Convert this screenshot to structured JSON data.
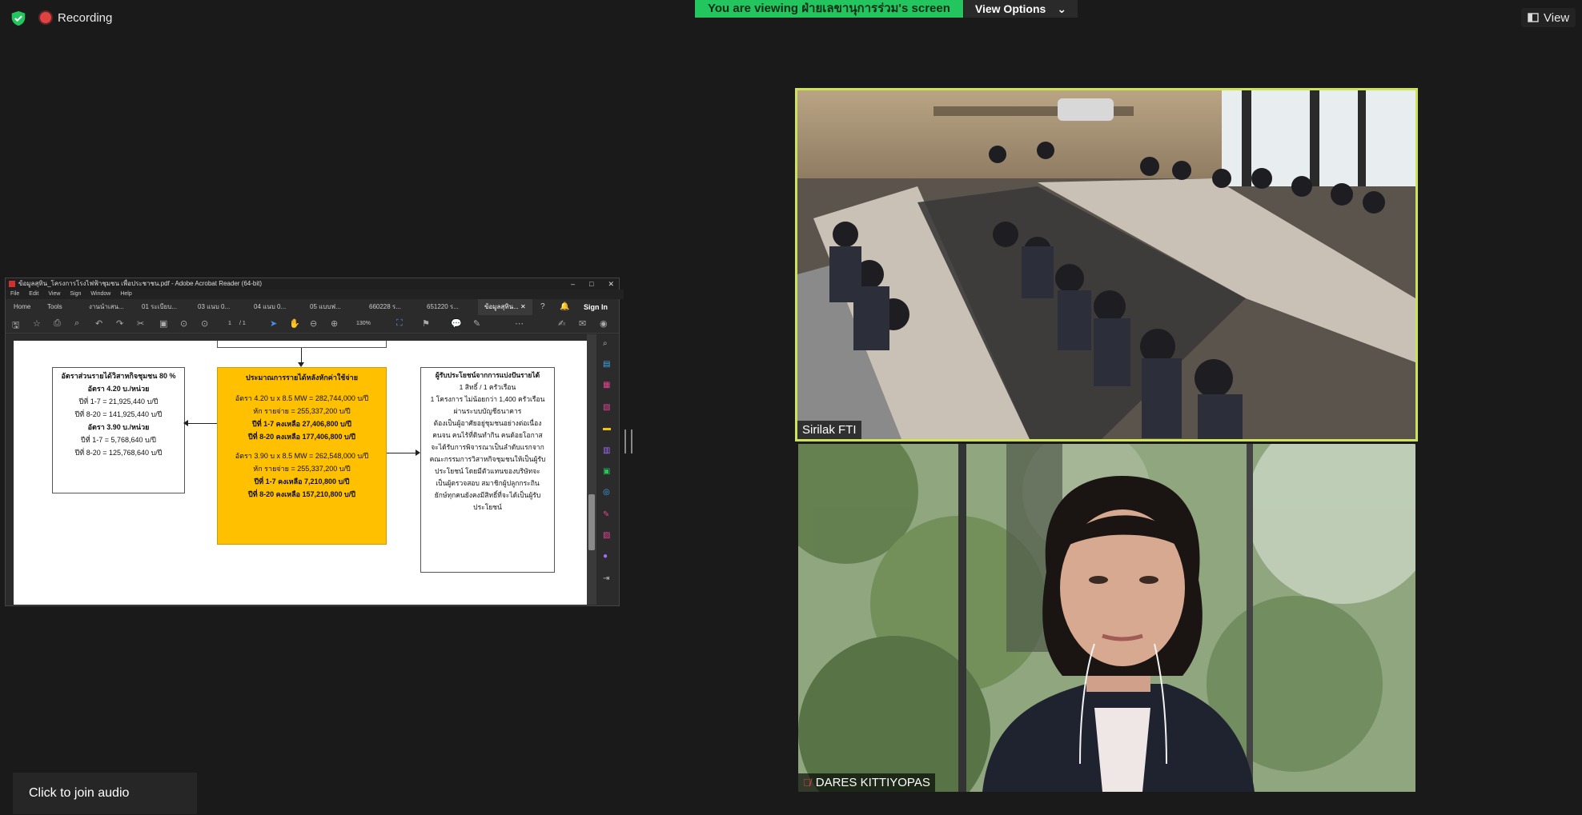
{
  "topbar": {
    "recording_label": "Recording",
    "viewing_banner": "You are viewing ฝ่ายเลขานุการร่วม's screen",
    "view_options_label": "View Options",
    "view_label": "View"
  },
  "acrobat": {
    "window_title": "ข้อมูลสุทิน_โครงการโรงไฟฟ้าชุมชน เพื่อประชาชน.pdf - Adobe Acrobat Reader (64-bit)",
    "menu": [
      "File",
      "Edit",
      "View",
      "Sign",
      "Window",
      "Help"
    ],
    "tabs": {
      "home": "Home",
      "tools": "Tools",
      "docs": [
        "งานนำเสน...",
        "01 ระเบียบ...",
        "03 แนบ 0...",
        "04 แนบ 0...",
        "05 แบบฟ...",
        "660228 ร...",
        "651220 ร...",
        "ข้อมูลสุทิน..."
      ],
      "sign_in": "Sign In"
    },
    "toolbar": {
      "page_current": "1",
      "page_total": "/ 1",
      "zoom": "130%"
    },
    "document": {
      "left_box": {
        "heading": "อัตราส่วนรายได้วิสาหกิจชุมชน 80 %",
        "rate1": "อัตรา 4.20 บ./หน่วย",
        "rate1_y1_7": "ปีที่ 1-7 = 21,925,440 บ/ปี",
        "rate1_y8_20": "ปีที่ 8-20 = 141,925,440 บ/ปี",
        "rate2": "อัตรา 3.90 บ./หน่วย",
        "rate2_y1_7": "ปีที่ 1-7 = 5,768,640 บ/ปี",
        "rate2_y8_20": "ปีที่ 8-20 = 125,768,640 บ/ปี"
      },
      "center_box": {
        "heading": "ประมาณการรายได้หลังหักค่าใช้จ่าย",
        "line1": "อัตรา 4.20 บ x 8.5 MW = 282,744,000 บ/ปี",
        "line2": "หัก รายจ่าย = 255,337,200 บ/ปี",
        "line3": "ปีที่ 1-7 คงเหลือ 27,406,800 บ/ปี",
        "line4": "ปีที่ 8-20 คงเหลือ 177,406,800 บ/ปี",
        "line5": "อัตรา 3.90 บ x 8.5 MW = 262,548,000 บ/ปี",
        "line6": "หัก รายจ่าย = 255,337,200 บ/ปี",
        "line7": "ปีที่ 1-7 คงเหลือ 7,210,800 บ/ปี",
        "line8": "ปีที่ 8-20 คงเหลือ 157,210,800 บ/ปี"
      },
      "right_box": {
        "heading": "ผู้รับประโยชน์จากการแบ่งปันรายได้",
        "lines": [
          "1 สิทธิ์ / 1 ครัวเรือน",
          "1 โครงการ ไม่น้อยกว่า 1,400 ครัวเรือน",
          "ผ่านระบบบัญชีธนาคาร",
          "ต้องเป็นผู้อาศัยอยู่ชุมชนอย่างต่อเนื่อง",
          "คนจน คนไร้ที่ดินทำกิน คนด้อยโอกาส",
          "จะได้รับการพิจารณาเป็นลำดับแรกจาก",
          "คณะกรรมการวิสาหกิจชุมชนให้เป็นผู้รับ",
          "ประโยชน์ โดยมีตัวแทนของบริษัทจะ",
          "เป็นผู้ตรวจสอบ สมาชิกผู้ปลูกกระถิน",
          "ยักษ์ทุกคนยังคงมีสิทธิ์ที่จะได้เป็นผู้รับ",
          "ประโยชน์"
        ]
      }
    }
  },
  "participants": [
    {
      "name": "Sirilak FTI",
      "muted": false,
      "active_speaker": true
    },
    {
      "name": "DARES KITTIYOPAS",
      "muted": true,
      "active_speaker": false
    }
  ],
  "bottom": {
    "join_audio_label": "Click to join audio"
  },
  "colors": {
    "banner_green": "#23c55e",
    "active_speaker_border": "#cfe35a",
    "recording_red": "#e04242"
  }
}
